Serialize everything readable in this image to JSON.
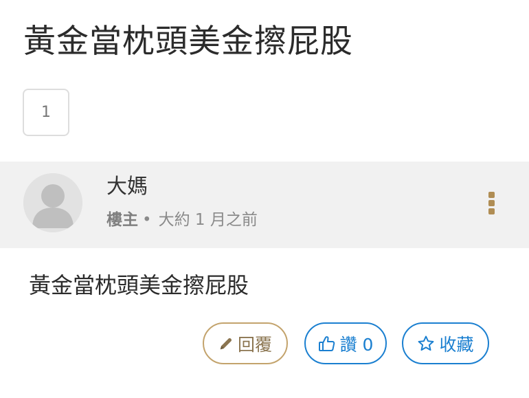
{
  "thread": {
    "title": "黃金當枕頭美金擦屁股"
  },
  "pagination": {
    "current_page": "1"
  },
  "post": {
    "author": "大媽",
    "op_badge": "樓主",
    "separator": "•",
    "time": "大約 1 月之前",
    "content": "黃金當枕頭美金擦屁股",
    "menu_icon": "kebab-menu-icon"
  },
  "actions": {
    "reply": {
      "label": "回覆",
      "icon": "pencil-icon"
    },
    "like": {
      "label": "讚 0",
      "icon": "thumbs-up-icon"
    },
    "favorite": {
      "label": "收藏",
      "icon": "star-outline-icon"
    }
  },
  "colors": {
    "header_bg": "#f1f1f1",
    "accent_gold": "#b08d54",
    "accent_blue": "#1a7fd0"
  }
}
